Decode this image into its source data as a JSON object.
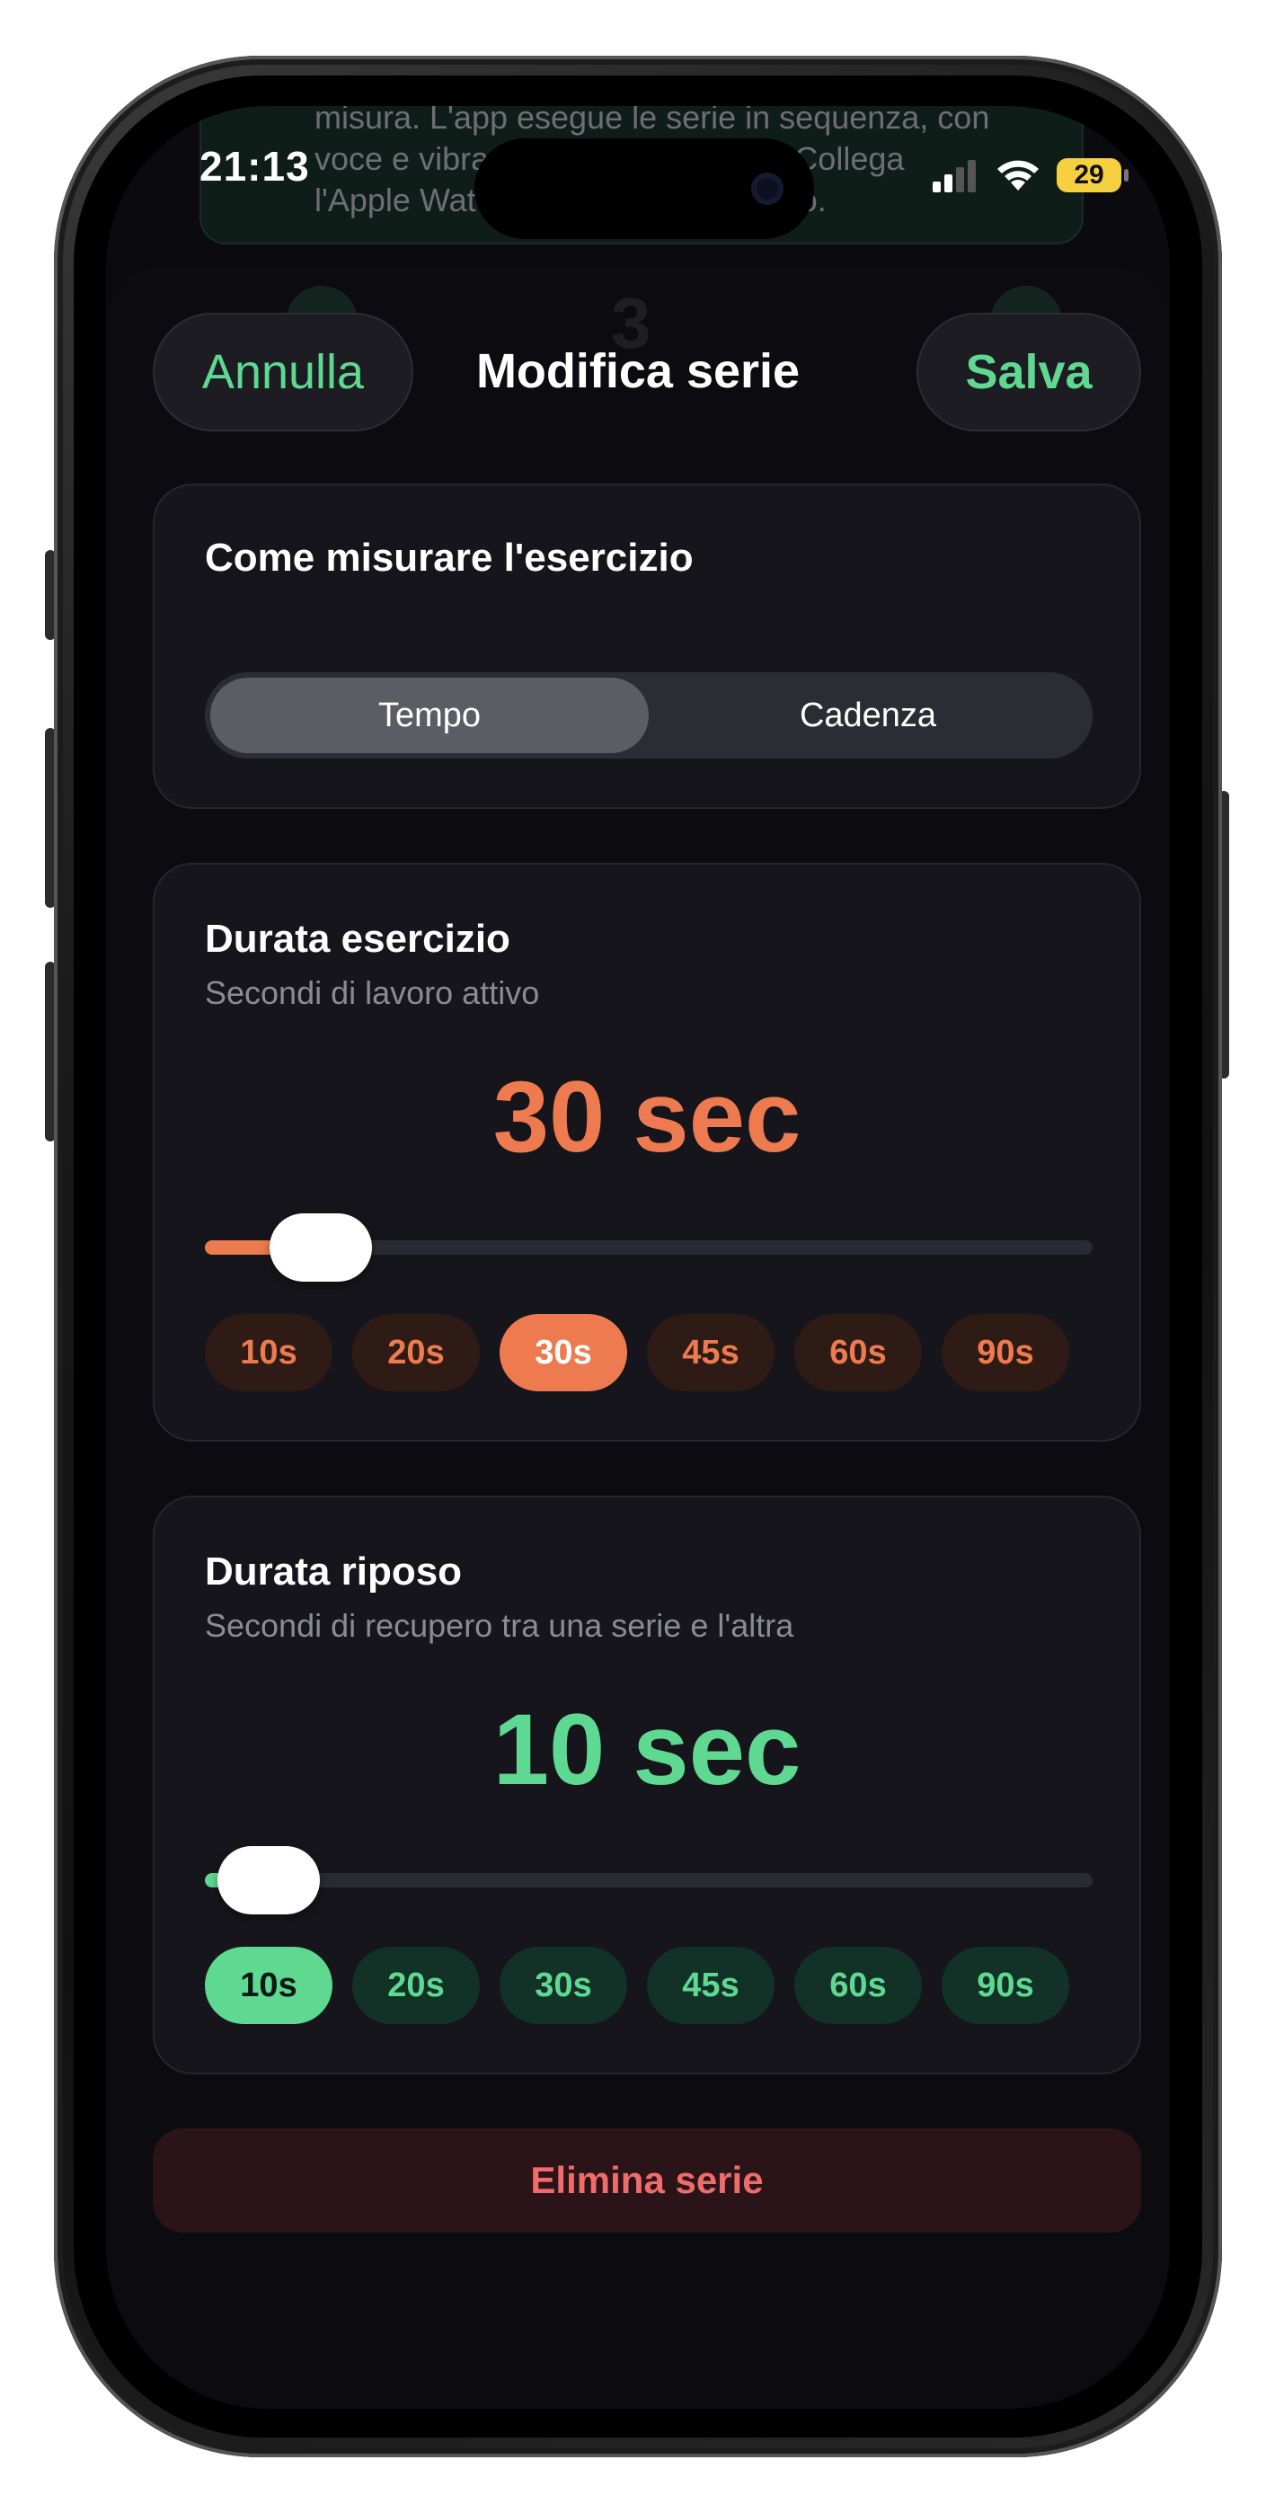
{
  "status": {
    "time": "21:13",
    "battery": "29"
  },
  "background": {
    "lines": [
      "misura. L'app esegue le serie in sequenza, con",
      "voce e vibrazione a ogni cambio. Collega",
      "l'Apple Watch per il battito cardiaco."
    ],
    "ghost_count": "3"
  },
  "nav": {
    "cancel_label": "Annulla",
    "title": "Modifica serie",
    "save_label": "Salva"
  },
  "measure": {
    "title": "Come misurare l'esercizio",
    "options": [
      "Tempo",
      "Cadenza"
    ],
    "selected": "Tempo"
  },
  "exercise": {
    "title": "Durata esercizio",
    "subtitle": "Secondi di lavoro attivo",
    "value_label": "30 sec",
    "value_seconds": 30,
    "slider_fraction": 0.07,
    "presets": [
      "10s",
      "20s",
      "30s",
      "45s",
      "60s",
      "90s"
    ],
    "selected_preset": "30s",
    "accent_color": "#ee7a4f"
  },
  "rest": {
    "title": "Durata riposo",
    "subtitle": "Secondi di recupero tra una serie e l'altra",
    "value_label": "10 sec",
    "value_seconds": 10,
    "slider_fraction": 0.0,
    "presets": [
      "10s",
      "20s",
      "30s",
      "45s",
      "60s",
      "90s"
    ],
    "selected_preset": "10s",
    "accent_color": "#5fd891"
  },
  "delete_label": "Elimina serie"
}
